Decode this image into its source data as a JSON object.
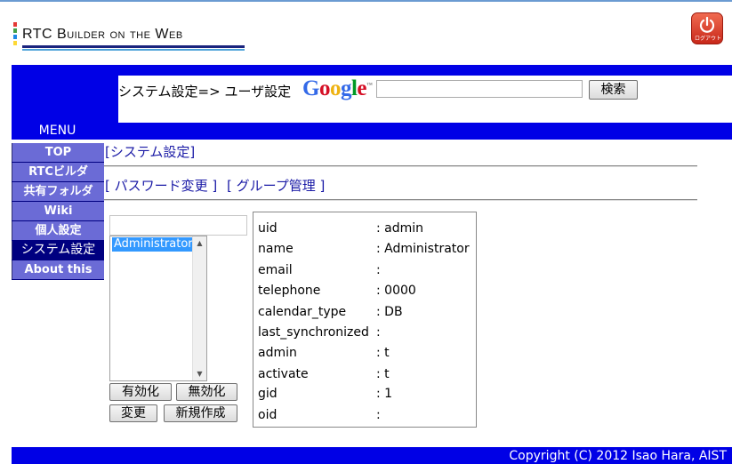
{
  "header": {
    "app_title": "RTC Builder on the Web",
    "logo_bar_colors": [
      "#e53935",
      "#43a047",
      "#1e88e5",
      "#fdd835"
    ],
    "logout_label": "ログアウト",
    "breadcrumb": "システム設定=> ユーザ設定",
    "google_letters": [
      "G",
      "o",
      "o",
      "g",
      "l",
      "e"
    ],
    "google_colors": [
      "#3369e8",
      "#d50f25",
      "#eeb211",
      "#3369e8",
      "#009925",
      "#d50f25"
    ],
    "google_tm": "™",
    "search_value": "",
    "search_button": "検索"
  },
  "menu": {
    "label": "MENU",
    "items": [
      {
        "label": "TOP",
        "active": false
      },
      {
        "label": "RTCビルダ",
        "active": false
      },
      {
        "label": "共有フォルダ",
        "active": false
      },
      {
        "label": "Wiki",
        "active": false
      },
      {
        "label": "個人設定",
        "active": false
      },
      {
        "label": "システム設定",
        "active": true
      },
      {
        "label": "About this",
        "active": false
      }
    ]
  },
  "main": {
    "section_link": "[システム設定]",
    "password_link": "[ パスワード変更 ]",
    "group_link": "[ グループ管理 ]",
    "filter_value": "",
    "user_list": [
      "Administrator"
    ],
    "buttons": {
      "enable": "有効化",
      "disable": "無効化",
      "edit": "変更",
      "new": "新規作成"
    },
    "user_info": [
      {
        "key": "uid",
        "value": ": admin"
      },
      {
        "key": "name",
        "value": ": Administrator"
      },
      {
        "key": "email",
        "value": ":"
      },
      {
        "key": "telephone",
        "value": ": 0000"
      },
      {
        "key": "calendar_type",
        "value": ": DB"
      },
      {
        "key": "last_synchronized",
        "value": ":"
      },
      {
        "key": "admin",
        "value": ": t"
      },
      {
        "key": "activate",
        "value": ": t"
      },
      {
        "key": "gid",
        "value": ": 1"
      },
      {
        "key": "oid",
        "value": ":"
      }
    ]
  },
  "footer": {
    "copyright": "Copyright (C) 2012 Isao Hara, AIST"
  },
  "colors": {
    "primary_blue": "#0000e6",
    "menu_item": "#6b6bd6",
    "menu_active": "#000080",
    "link": "#1a1aa6"
  }
}
